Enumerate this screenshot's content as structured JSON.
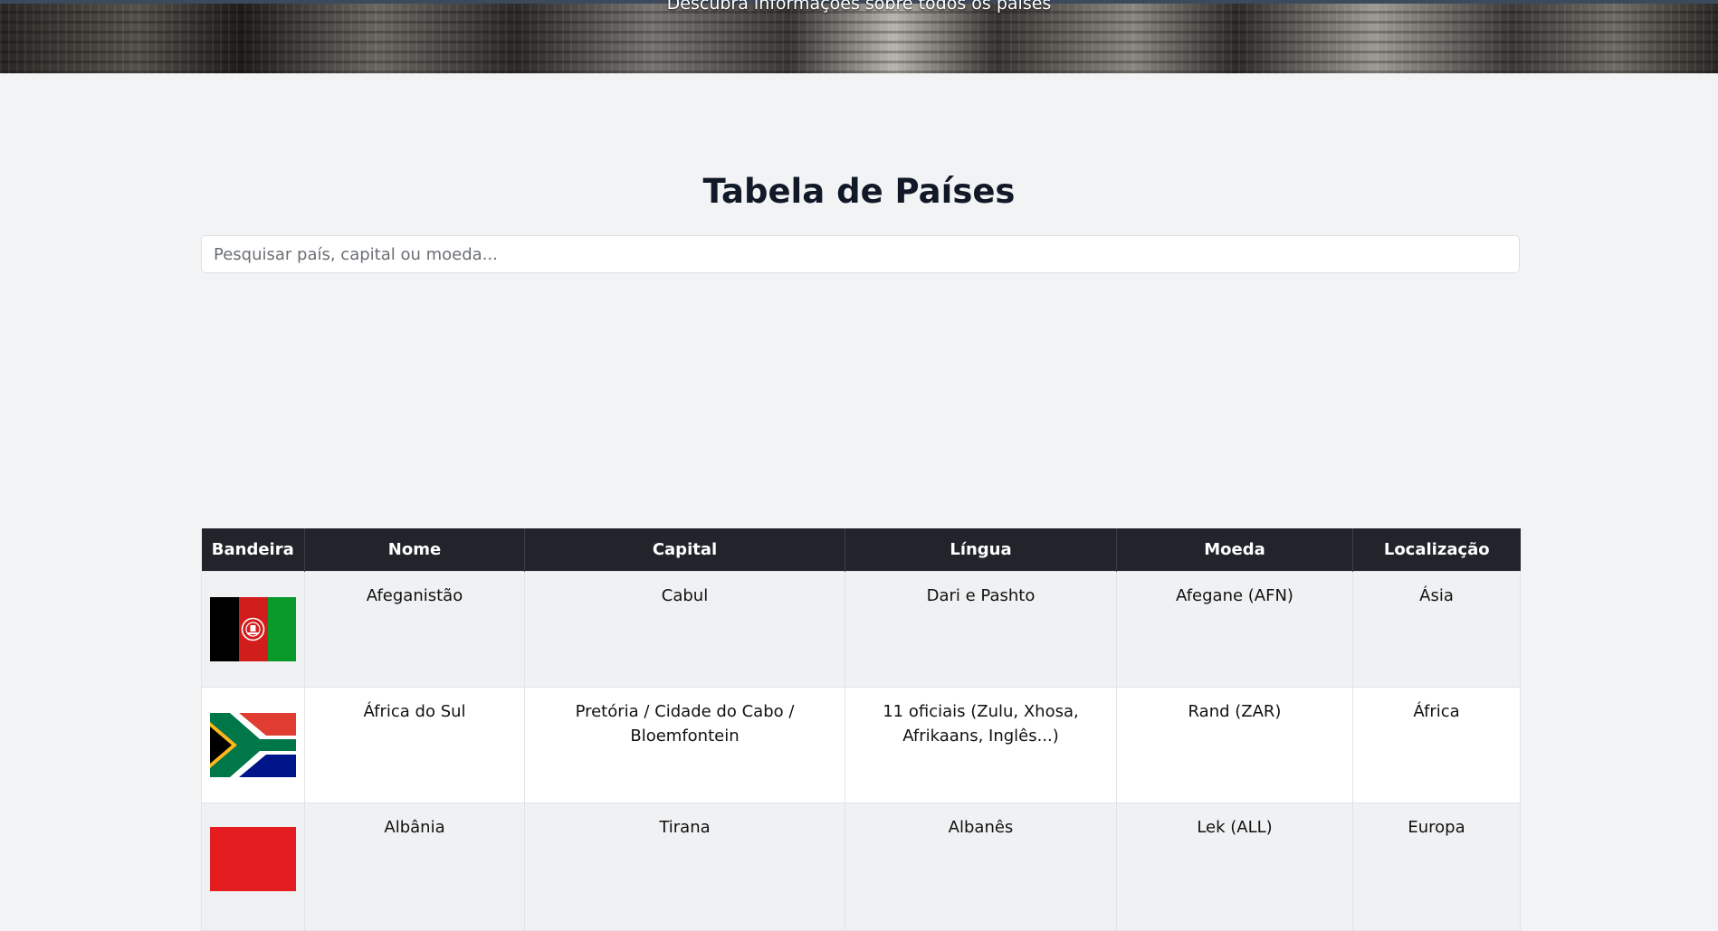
{
  "hero": {
    "subtitle": "Descubra informações sobre todos os países"
  },
  "page_title": "Tabela de Países",
  "search": {
    "placeholder": "Pesquisar país, capital ou moeda...",
    "value": ""
  },
  "table": {
    "headers": [
      "Bandeira",
      "Nome",
      "Capital",
      "Língua",
      "Moeda",
      "Localização"
    ],
    "rows": [
      {
        "flag_icon": "afghanistan-flag",
        "name": "Afeganistão",
        "capital": "Cabul",
        "language": "Dari e Pashto",
        "currency": "Afegane (AFN)",
        "location": "Ásia"
      },
      {
        "flag_icon": "south-africa-flag",
        "name": "África do Sul",
        "capital": "Pretória / Cidade do Cabo / Bloemfontein",
        "language": "11 oficiais (Zulu, Xhosa, Afrikaans, Inglês...)",
        "currency": "Rand (ZAR)",
        "location": "África"
      },
      {
        "flag_icon": "albania-flag",
        "name": "Albânia",
        "capital": "Tirana",
        "language": "Albanês",
        "currency": "Lek (ALL)",
        "location": "Europa"
      }
    ]
  },
  "colors": {
    "header_bg": "#21252b",
    "page_bg": "#f2f3f4",
    "odd_row_bg": "#f0f1f2"
  }
}
